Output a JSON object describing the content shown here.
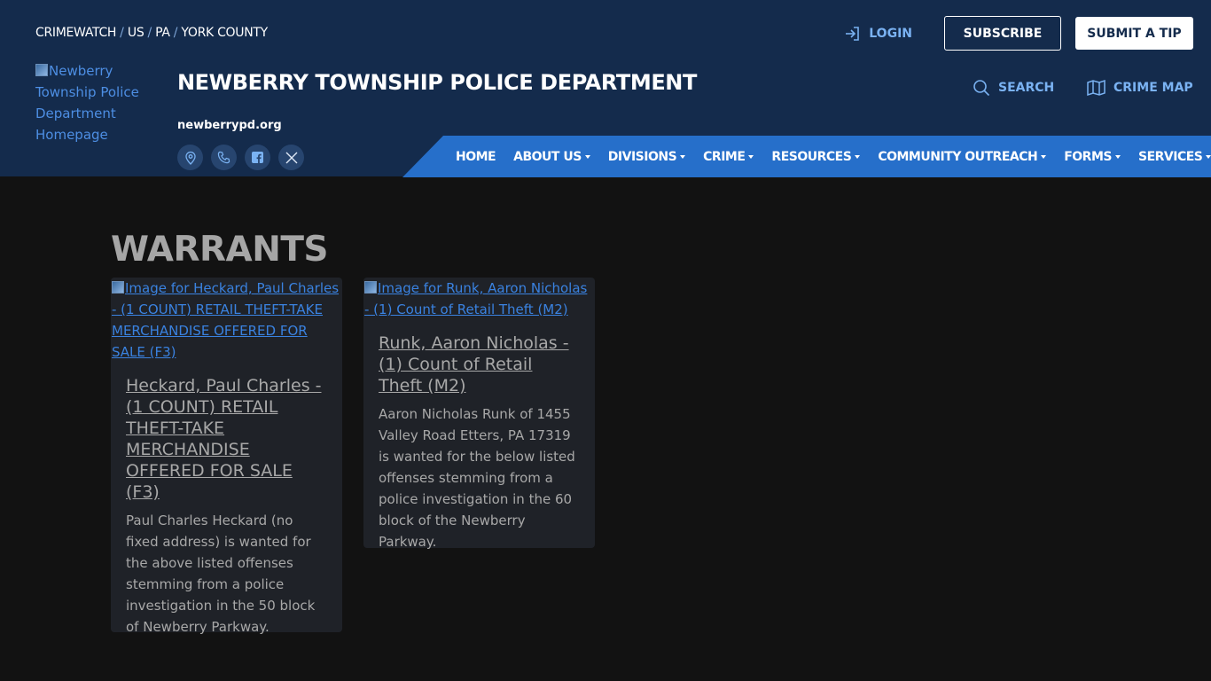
{
  "breadcrumb": {
    "items": [
      "CRIMEWATCH",
      "US",
      "PA",
      "YORK COUNTY"
    ],
    "separator": "/"
  },
  "top_actions": {
    "login": "LOGIN",
    "subscribe": "SUBSCRIBE",
    "submit_tip": "SUBMIT A TIP"
  },
  "logo": {
    "alt": "Newberry Township Police Department Homepage"
  },
  "department": {
    "title": "NEWBERRY TOWNSHIP POLICE DEPARTMENT",
    "url": "newberrypd.org"
  },
  "socials": [
    "location-icon",
    "phone-icon",
    "facebook-icon",
    "x-icon"
  ],
  "tools": {
    "search": "SEARCH",
    "crime_map": "CRIME MAP"
  },
  "nav": {
    "items": [
      {
        "label": "HOME",
        "dropdown": false
      },
      {
        "label": "ABOUT US",
        "dropdown": true
      },
      {
        "label": "DIVISIONS",
        "dropdown": true
      },
      {
        "label": "CRIME",
        "dropdown": true
      },
      {
        "label": "RESOURCES",
        "dropdown": true
      },
      {
        "label": "COMMUNITY OUTREACH",
        "dropdown": true
      },
      {
        "label": "FORMS",
        "dropdown": true
      },
      {
        "label": "SERVICES",
        "dropdown": true
      }
    ]
  },
  "page": {
    "title": "WARRANTS"
  },
  "cards": [
    {
      "image_alt": "Image for Heckard, Paul Charles - (1 COUNT) RETAIL THEFT-TAKE MERCHANDISE OFFERED FOR SALE (F3)",
      "title": "Heckard, Paul Charles - (1 COUNT) RETAIL THEFT-TAKE MERCHANDISE OFFERED FOR SALE (F3)",
      "text": "Paul Charles Heckard (no fixed address) is wanted for the above listed offenses stemming from a police investigation in the 50 block of Newberry Parkway."
    },
    {
      "image_alt": "Image for Runk, Aaron Nicholas - (1) Count of Retail Theft (M2)",
      "title": "Runk, Aaron Nicholas - (1) Count of Retail Theft (M2)",
      "text": "Aaron Nicholas Runk of 1455 Valley Road Etters, PA  17319 is wanted for the below listed offenses stemming from a police investigation in the 60 block of the Newberry Parkway."
    }
  ],
  "colors": {
    "header_bg": "#142b4c",
    "nav_bg": "#266fca",
    "accent_link": "#7ab2f2",
    "page_bg": "#121212",
    "card_bg": "#1f2228"
  }
}
